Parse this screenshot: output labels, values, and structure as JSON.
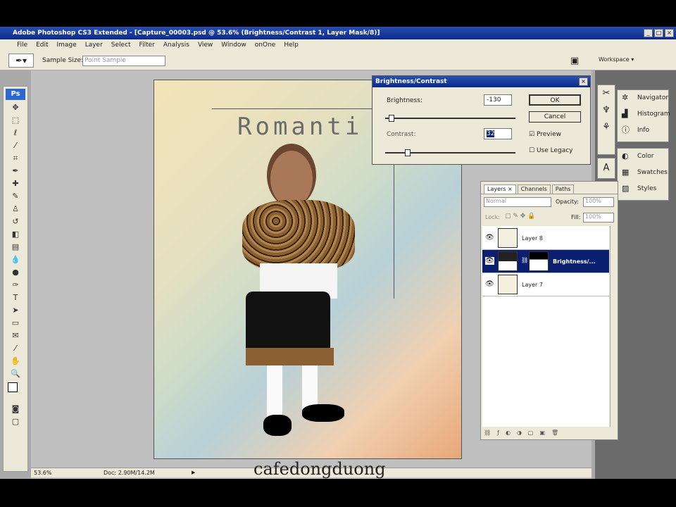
{
  "title": "Adobe Photoshop CS3 Extended - [Capture_00003.psd @ 53.6% (Brightness/Contrast 1, Layer Mask/8)]",
  "menu": [
    "File",
    "Edit",
    "Image",
    "Layer",
    "Select",
    "Filter",
    "Analysis",
    "View",
    "Window",
    "onOne",
    "Help"
  ],
  "options": {
    "sample_size_label": "Sample Size:",
    "sample_size_value": "Point Sample",
    "workspace": "Workspace ▾"
  },
  "canvas": {
    "text": "Romanti"
  },
  "status": {
    "zoom": "53.6%",
    "doc": "Doc: 2.90M/14.2M"
  },
  "watermark": "cafedongduong",
  "dialog": {
    "title": "Brightness/Contrast",
    "brightness_label": "Brightness:",
    "brightness_value": "-130",
    "brightness_fraction": 0.03,
    "contrast_label": "Contrast:",
    "contrast_value": "32",
    "contrast_fraction": 0.16,
    "ok": "OK",
    "cancel": "Cancel",
    "preview": "Preview",
    "preview_checked": true,
    "use_legacy": "Use Legacy",
    "use_legacy_checked": false
  },
  "layers_panel": {
    "tabs": [
      "Layers ×",
      "Channels",
      "Paths"
    ],
    "blend_mode": "Normal",
    "opacity_label": "Opacity:",
    "opacity_value": "100%",
    "lock_label": "Lock:",
    "fill_label": "Fill:",
    "fill_value": "100%",
    "layers": [
      {
        "name": "Layer 8",
        "selected": false
      },
      {
        "name": "Brightness/...",
        "selected": true
      },
      {
        "name": "Layer 7",
        "selected": false
      }
    ]
  },
  "right_panels": {
    "group1": [
      "Navigator",
      "Histogram",
      "Info"
    ],
    "group2": [
      "Color",
      "Swatches",
      "Styles"
    ]
  },
  "toolbox_logo": "Ps"
}
